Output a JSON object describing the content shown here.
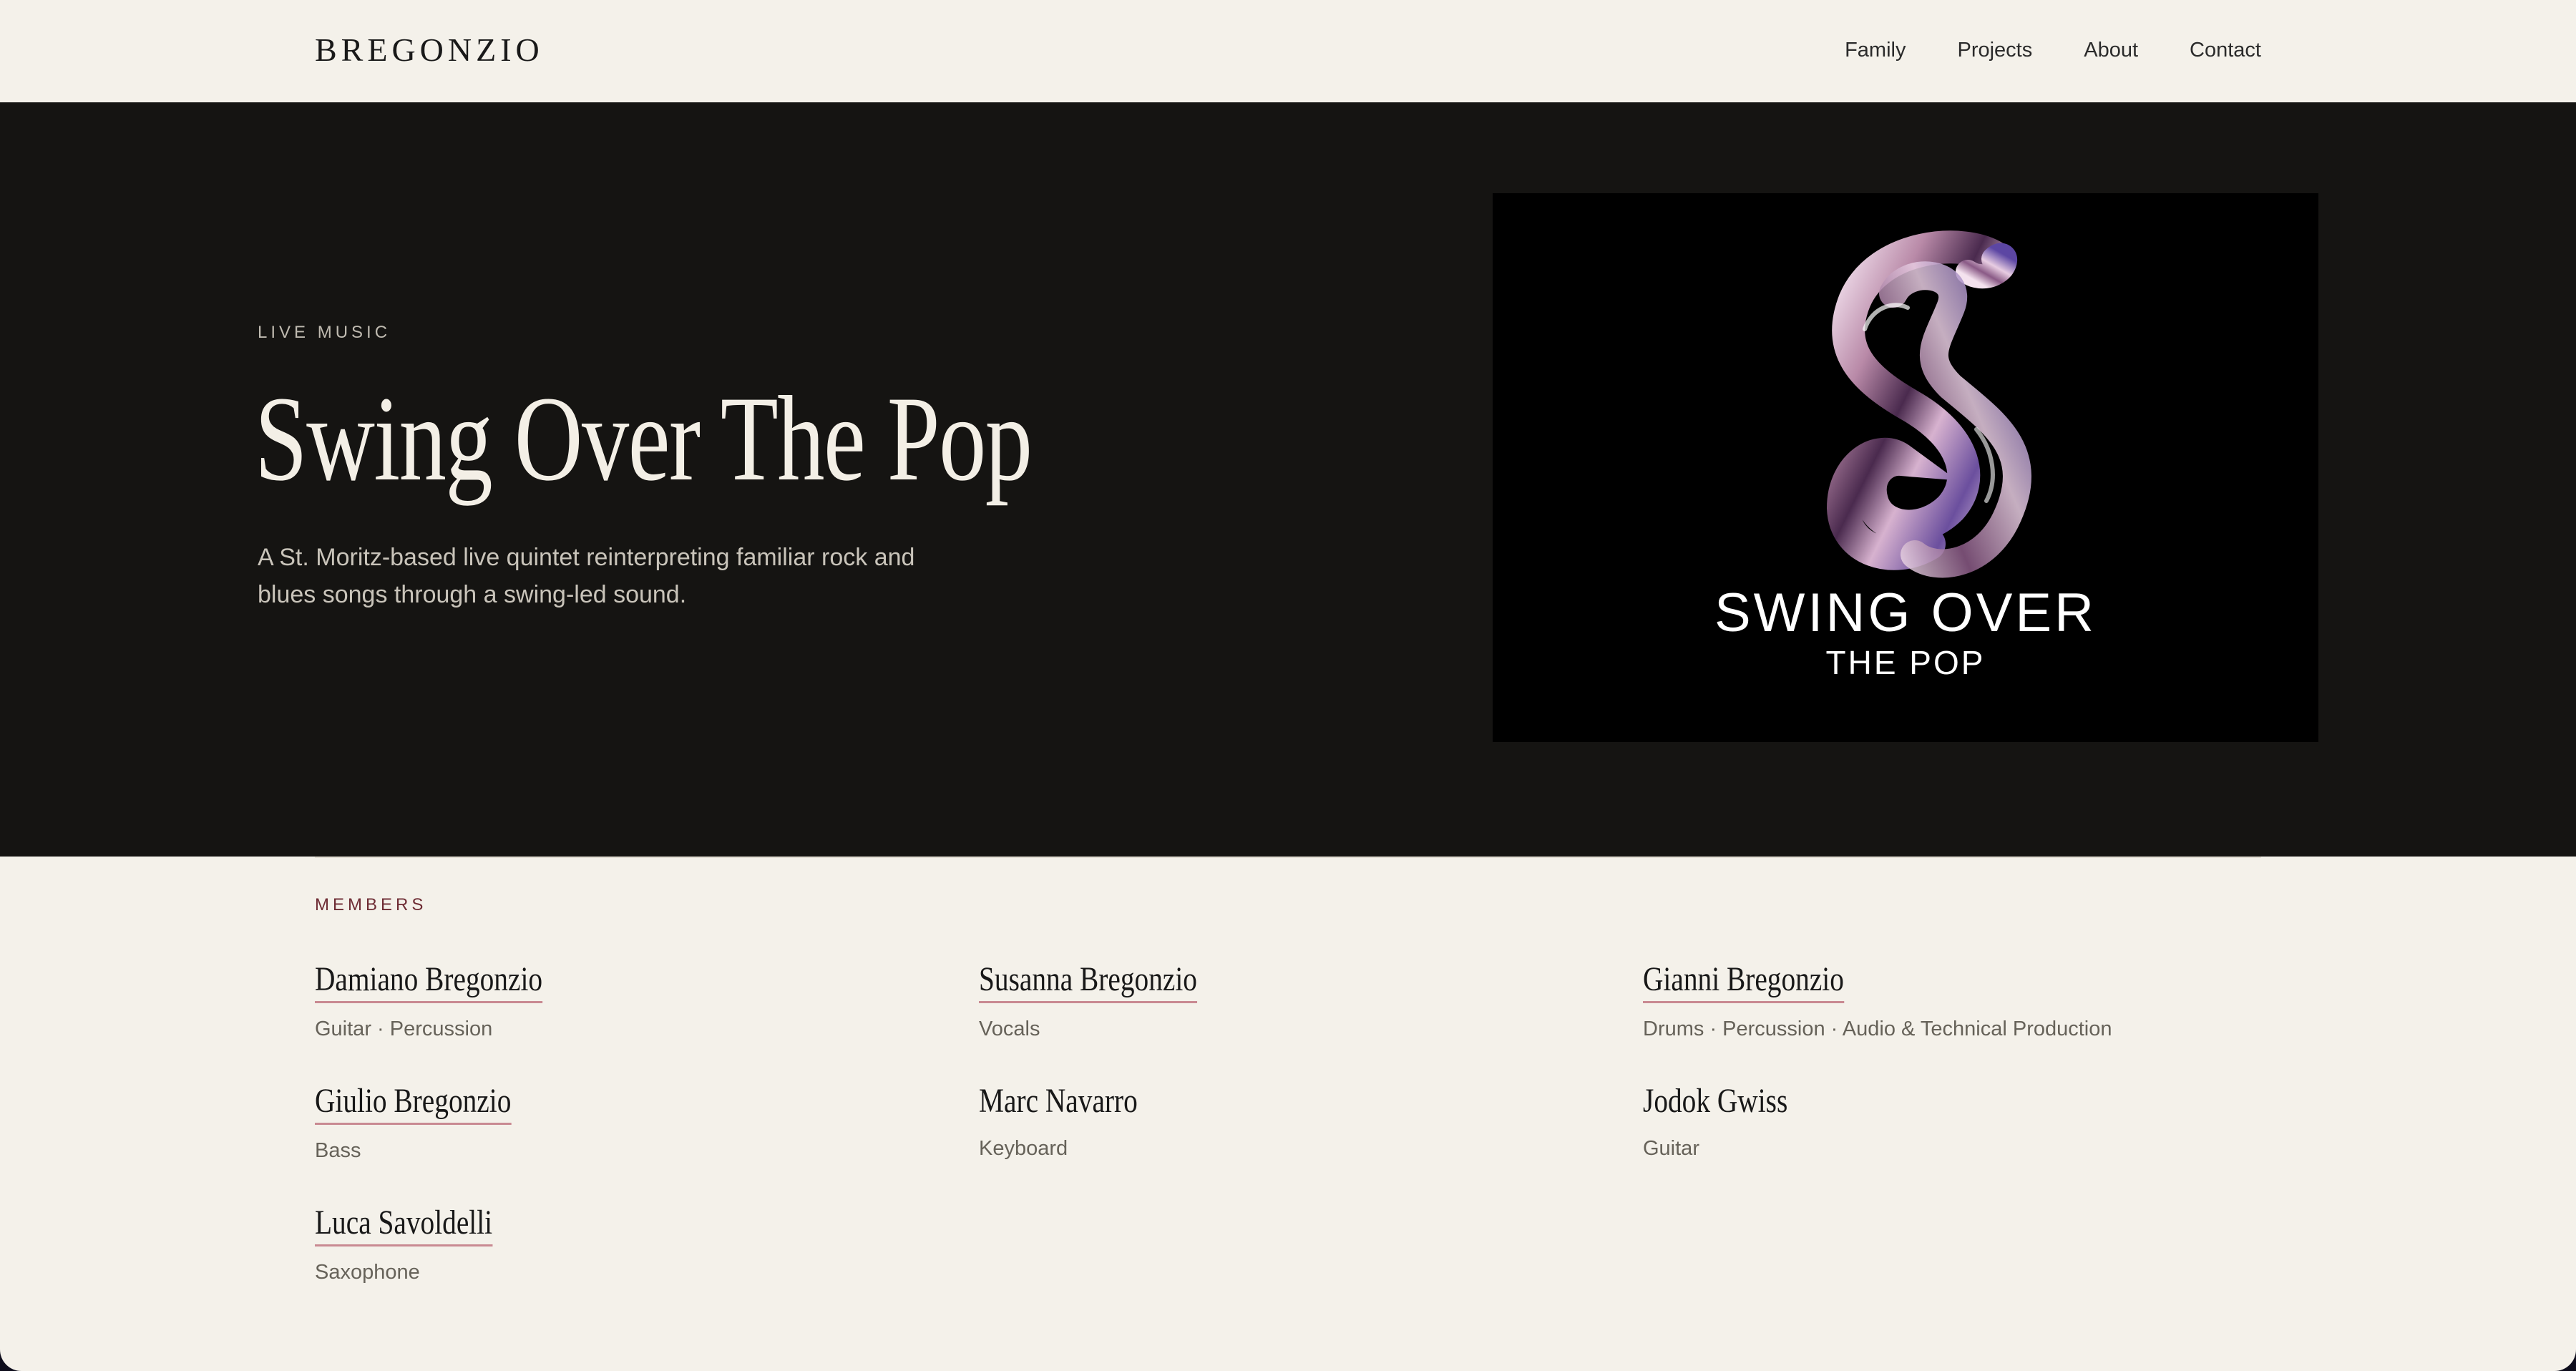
{
  "header": {
    "brand": "BREGONZIO",
    "nav": [
      "Family",
      "Projects",
      "About",
      "Contact"
    ]
  },
  "hero": {
    "eyebrow": "LIVE MUSIC",
    "title": "Swing Over The Pop",
    "description": "A St. Moritz-based live quintet reinterpreting familiar rock and blues songs through a swing-led sound.",
    "artwork": {
      "line1": "SWING OVER",
      "line2": "THE POP",
      "icon": "chrome-s-logo-icon"
    }
  },
  "members": {
    "label": "MEMBERS",
    "items": [
      {
        "name": "Damiano Bregonzio",
        "role": "Guitar · Percussion",
        "linked": true
      },
      {
        "name": "Susanna Bregonzio",
        "role": "Vocals",
        "linked": true
      },
      {
        "name": "Gianni Bregonzio",
        "role": "Drums · Percussion · Audio & Technical Production",
        "linked": true
      },
      {
        "name": "Giulio Bregonzio",
        "role": "Bass",
        "linked": true
      },
      {
        "name": "Marc Navarro",
        "role": "Keyboard",
        "linked": false
      },
      {
        "name": "Jodok Gwiss",
        "role": "Guitar",
        "linked": false
      },
      {
        "name": "Luca Savoldelli",
        "role": "Saxophone",
        "linked": true
      }
    ]
  },
  "colors": {
    "page_background": "#f4f1ea",
    "hero_background": "#151412",
    "accent_text": "#6e2c34",
    "link_underline": "#c98a92"
  }
}
